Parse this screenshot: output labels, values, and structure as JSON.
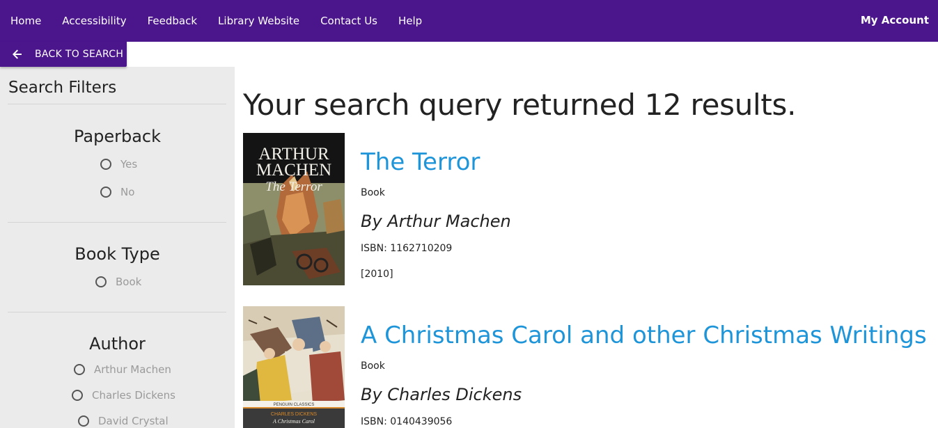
{
  "nav": {
    "links": [
      "Home",
      "Accessibility",
      "Feedback",
      "Library Website",
      "Contact Us",
      "Help"
    ],
    "account": "My Account"
  },
  "back_button": {
    "label": "BACK TO SEARCH",
    "icon": "arrow-left-icon"
  },
  "sidebar": {
    "title": "Search Filters",
    "groups": [
      {
        "heading": "Paperback",
        "options": [
          "Yes",
          "No"
        ]
      },
      {
        "heading": "Book Type",
        "options": [
          "Book"
        ]
      },
      {
        "heading": "Author",
        "options": [
          "Arthur Machen",
          "Charles Dickens",
          "David Crystal"
        ]
      }
    ]
  },
  "results": {
    "summary": "Your search query returned 12 results.",
    "items": [
      {
        "title": "The Terror",
        "type": "Book",
        "author": "By Arthur Machen",
        "isbn": "ISBN: 1162710209",
        "year": "[2010]",
        "cover": {
          "line1": "ARTHUR",
          "line2": "MACHEN",
          "line3": "The Terror"
        }
      },
      {
        "title": "A Christmas Carol and other Christmas Writings",
        "type": "Book",
        "author": "By Charles Dickens",
        "isbn": "ISBN: 0140439056",
        "cover": {
          "publisher": "PENGUIN  CLASSICS",
          "author": "CHARLES DICKENS",
          "subtitle": "A Christmas Carol"
        }
      }
    ]
  },
  "colors": {
    "nav_bg": "#4b158c",
    "link_blue": "#1e95d9",
    "sidebar_bg": "#ebebeb"
  }
}
